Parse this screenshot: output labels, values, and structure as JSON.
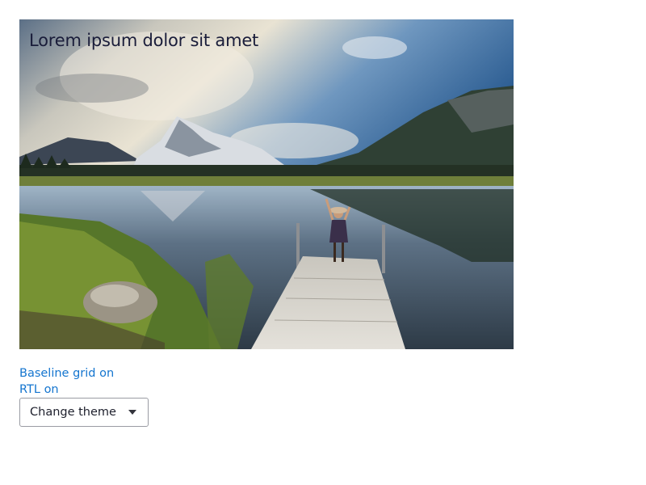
{
  "hero": {
    "title": "Lorem ipsum dolor sit amet",
    "image_icon": "landscape-photo"
  },
  "links": {
    "baseline_grid": "Baseline grid on",
    "rtl": "RTL on"
  },
  "theme_button": {
    "label": "Change theme",
    "icon": "caret-down-icon"
  },
  "colors": {
    "link": "#1475cf",
    "title": "#1a1d3a",
    "button_border": "#9a9ca3"
  }
}
